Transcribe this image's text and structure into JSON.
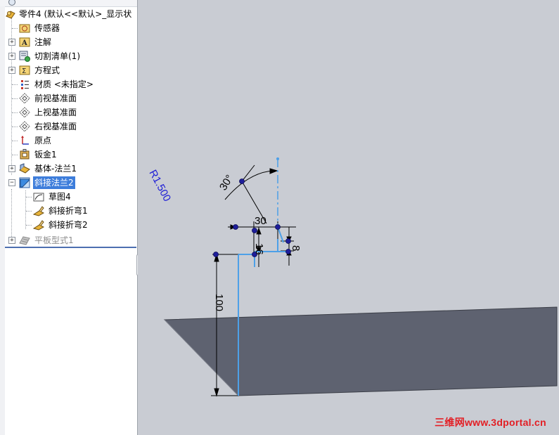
{
  "feature_tree": {
    "root": {
      "label": "零件4 (默认<<默认>_显示状",
      "icon": "part-icon"
    },
    "items": [
      {
        "label": "传感器",
        "icon": "sensor-icon",
        "expandable": false
      },
      {
        "label": "注解",
        "icon": "annotation-icon",
        "expandable": true
      },
      {
        "label": "切割清单(1)",
        "icon": "cut-list-icon",
        "expandable": true
      },
      {
        "label": "方程式",
        "icon": "equation-icon",
        "expandable": true
      },
      {
        "label": "材质 <未指定>",
        "icon": "material-icon",
        "expandable": false
      },
      {
        "label": "前视基准面",
        "icon": "plane-icon",
        "expandable": false
      },
      {
        "label": "上视基准面",
        "icon": "plane-icon",
        "expandable": false
      },
      {
        "label": "右视基准面",
        "icon": "plane-icon",
        "expandable": false
      },
      {
        "label": "原点",
        "icon": "origin-icon",
        "expandable": false
      },
      {
        "label": "钣金1",
        "icon": "sheet-metal-icon",
        "expandable": false
      },
      {
        "label": "基体-法兰1",
        "icon": "base-flange-icon",
        "expandable": true
      },
      {
        "label": "斜接法兰2",
        "icon": "miter-flange-icon",
        "expandable": true,
        "expanded": true,
        "selected": true
      },
      {
        "label": "草图4",
        "icon": "sketch-icon",
        "child": true
      },
      {
        "label": "斜接折弯1",
        "icon": "bend-icon",
        "child": true
      },
      {
        "label": "斜接折弯2",
        "icon": "bend-icon",
        "child": true
      },
      {
        "label": "平板型式1",
        "icon": "flat-pattern-icon",
        "expandable": true,
        "disabled": true
      }
    ]
  },
  "sketch": {
    "dimensions": {
      "angle": "30°",
      "radius": "R1.500",
      "horizontal": "30",
      "vertical_a": "16",
      "vertical_b": "8",
      "height": "100"
    },
    "colors": {
      "sketch_line": "#4da0e8",
      "point": "#1e1e9a",
      "radius_text": "#1c1cd6",
      "plate": "#5e6270",
      "background": "#c9ccd3"
    }
  },
  "watermark": "三维网www.3dportal.cn"
}
